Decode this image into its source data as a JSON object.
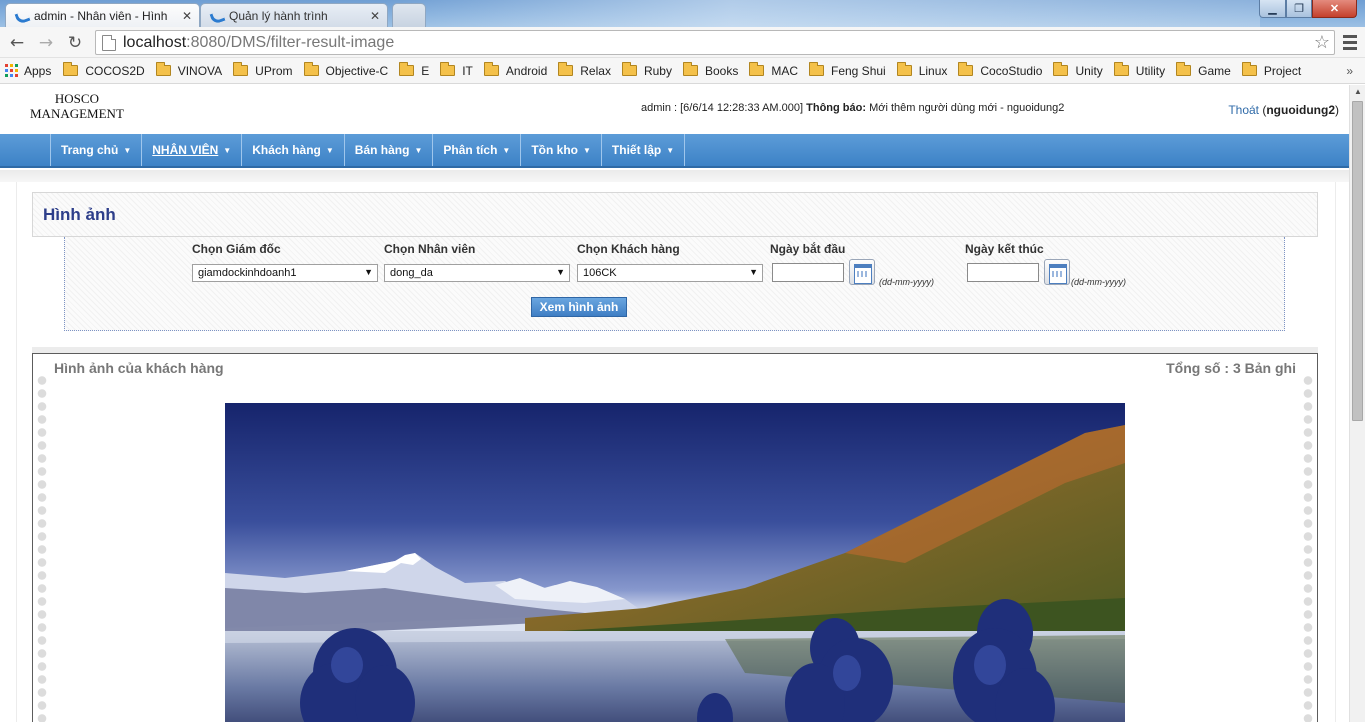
{
  "browser": {
    "tabs": [
      {
        "title": "admin - Nhân viên - Hình",
        "active": true
      },
      {
        "title": "Quản lý hành trình",
        "active": false
      }
    ],
    "url_host": "localhost",
    "url_rest": ":8080/DMS/filter-result-image",
    "bookmarks": [
      "Apps",
      "COCOS2D",
      "VINOVA",
      "UProm",
      "Objective-C",
      "E",
      "IT",
      "Android",
      "Relax",
      "Ruby",
      "Books",
      "MAC",
      "Feng Shui",
      "Linux",
      "CocoStudio",
      "Unity",
      "Utility",
      "Game",
      "Project"
    ],
    "icons": {
      "back": "back-arrow-icon",
      "forward": "forward-arrow-icon",
      "reload": "reload-icon",
      "star": "star-icon",
      "menu": "hamburger-menu-icon"
    }
  },
  "header": {
    "brand_line1": "HOSCO",
    "brand_line2": "MANAGEMENT",
    "notice_prefix": "admin : [6/6/14 12:28:33 AM.000]",
    "notice_label": "Thông báo:",
    "notice_text": "Mới thêm người dùng mới - nguoidung2",
    "logout_label": "Thoát",
    "username": "nguoidung2"
  },
  "nav": [
    {
      "label": "Trang chủ",
      "active": false
    },
    {
      "label": "NHÂN VIÊN",
      "active": true
    },
    {
      "label": "Khách hàng",
      "active": false
    },
    {
      "label": "Bán hàng",
      "active": false
    },
    {
      "label": "Phân tích",
      "active": false
    },
    {
      "label": "Tồn kho",
      "active": false
    },
    {
      "label": "Thiết lập",
      "active": false
    }
  ],
  "section": {
    "title": "Hình ảnh"
  },
  "filters": {
    "director_label": "Chọn Giám đốc",
    "director_value": "giamdockinhdoanh1",
    "employee_label": "Chọn Nhân viên",
    "employee_value": "dong_da",
    "customer_label": "Chọn Khách hàng",
    "customer_value": "106CK",
    "start_label": "Ngày bắt đầu",
    "end_label": "Ngày kết thúc",
    "date_hint": "(dd-mm-yyyy)",
    "submit_label": "Xem hình ảnh"
  },
  "results": {
    "title": "Hình ảnh của khách hàng",
    "count_text": "Tổng số : 3 Bản ghi",
    "image_subject": "mountain lake landscape with blue flowers"
  },
  "colors": {
    "nav_blue": "#4a8fd0",
    "title_navy": "#2d3e8a",
    "link": "#2f6aa8"
  }
}
